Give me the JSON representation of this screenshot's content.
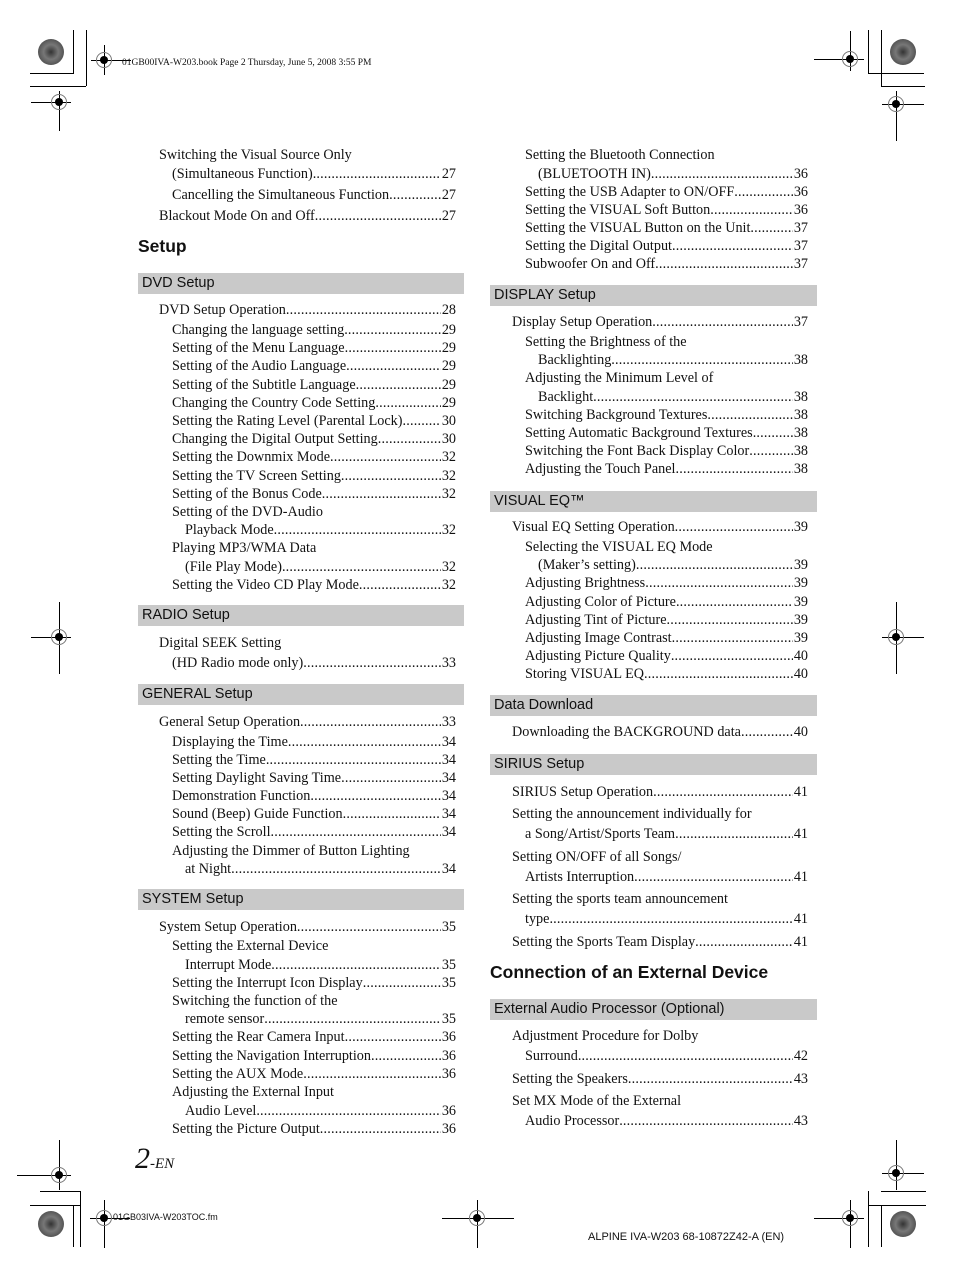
{
  "header": {
    "file_line": "01GB00IVA-W203.book  Page 2  Thursday, June 5, 2008  3:55 PM"
  },
  "footer": {
    "page_number": "2",
    "page_suffix": "-EN",
    "source_file": "01GB03IVA-W203TOC.fm",
    "product_code": "ALPINE IVA-W203 68-10872Z42-A (EN)"
  },
  "left": {
    "top_entries": [
      {
        "text": "Switching the Visual Source Only",
        "page": ""
      },
      {
        "text": "(Simultaneous Function)",
        "page": "27"
      },
      {
        "text": "Cancelling the Simultaneous Function",
        "page": "27"
      },
      {
        "text": "Blackout Mode On and Off",
        "page": "27"
      }
    ],
    "heading_setup": "Setup",
    "dvd": {
      "title": "DVD Setup",
      "entries": [
        {
          "text": "DVD Setup Operation",
          "page": "28"
        },
        {
          "text": "Changing the language setting",
          "page": "29"
        },
        {
          "text": "Setting of the Menu Language",
          "page": "29"
        },
        {
          "text": "Setting of the Audio Language",
          "page": "29"
        },
        {
          "text": "Setting of the Subtitle Language",
          "page": "29"
        },
        {
          "text": "Changing the Country Code Setting",
          "page": "29"
        },
        {
          "text": "Setting the Rating Level (Parental Lock)",
          "page": "30"
        },
        {
          "text": "Changing the Digital Output Setting",
          "page": "30"
        },
        {
          "text": "Setting the Downmix Mode",
          "page": "32"
        },
        {
          "text": "Setting the TV Screen Setting",
          "page": "32"
        },
        {
          "text": "Setting of the Bonus Code",
          "page": "32"
        },
        {
          "text": "Setting of the DVD-Audio",
          "page": ""
        },
        {
          "text": "Playback Mode",
          "page": "32"
        },
        {
          "text": "Playing MP3/WMA Data",
          "page": ""
        },
        {
          "text": "(File Play Mode)",
          "page": "32"
        },
        {
          "text": "Setting the Video CD Play Mode",
          "page": "32"
        }
      ]
    },
    "radio": {
      "title": "RADIO Setup",
      "entries": [
        {
          "text": "Digital SEEK Setting",
          "page": ""
        },
        {
          "text": "(HD Radio mode only)",
          "page": "33"
        }
      ]
    },
    "general": {
      "title": "GENERAL Setup",
      "entries": [
        {
          "text": "General Setup Operation",
          "page": "33"
        },
        {
          "text": "Displaying the Time",
          "page": "34"
        },
        {
          "text": "Setting the Time",
          "page": "34"
        },
        {
          "text": "Setting Daylight Saving Time",
          "page": "34"
        },
        {
          "text": "Demonstration Function",
          "page": "34"
        },
        {
          "text": "Sound (Beep) Guide Function",
          "page": "34"
        },
        {
          "text": "Setting the Scroll",
          "page": "34"
        },
        {
          "text": "Adjusting the Dimmer of Button Lighting",
          "page": ""
        },
        {
          "text": "at Night",
          "page": "34"
        }
      ]
    },
    "system": {
      "title": "SYSTEM Setup",
      "entries": [
        {
          "text": "System Setup Operation",
          "page": "35"
        },
        {
          "text": "Setting the External Device",
          "page": ""
        },
        {
          "text": "Interrupt Mode",
          "page": "35"
        },
        {
          "text": "Setting the Interrupt Icon Display",
          "page": "35"
        },
        {
          "text": "Switching the function of the",
          "page": ""
        },
        {
          "text": "remote sensor",
          "page": "35"
        },
        {
          "text": "Setting the Rear Camera Input",
          "page": "36"
        },
        {
          "text": "Setting the Navigation Interruption",
          "page": "36"
        },
        {
          "text": "Setting the AUX Mode",
          "page": "36"
        },
        {
          "text": "Adjusting the External Input",
          "page": ""
        },
        {
          "text": "Audio Level",
          "page": "36"
        },
        {
          "text": "Setting the Picture Output",
          "page": "36"
        }
      ]
    }
  },
  "right": {
    "top_entries": [
      {
        "text": "Setting the Bluetooth Connection",
        "page": ""
      },
      {
        "text": "(BLUETOOTH IN)",
        "page": "36"
      },
      {
        "text": "Setting the USB Adapter to ON/OFF",
        "page": "36"
      },
      {
        "text": "Setting the VISUAL Soft Button",
        "page": "36"
      },
      {
        "text": "Setting the VISUAL Button on the Unit",
        "page": "37"
      },
      {
        "text": "Setting the Digital Output",
        "page": "37"
      },
      {
        "text": "Subwoofer On and Off",
        "page": "37"
      }
    ],
    "display": {
      "title": "DISPLAY Setup",
      "entries": [
        {
          "text": "Display Setup Operation",
          "page": "37"
        },
        {
          "text": "Setting the Brightness of the",
          "page": ""
        },
        {
          "text": "Backlighting",
          "page": "38"
        },
        {
          "text": "Adjusting the Minimum Level of",
          "page": ""
        },
        {
          "text": "Backlight",
          "page": "38"
        },
        {
          "text": "Switching Background Textures",
          "page": "38"
        },
        {
          "text": "Setting Automatic Background Textures",
          "page": "38"
        },
        {
          "text": "Switching the Font Back Display Color",
          "page": "38"
        },
        {
          "text": "Adjusting the Touch Panel",
          "page": "38"
        }
      ]
    },
    "visualeq": {
      "title": "VISUAL EQ™",
      "entries": [
        {
          "text": "Visual EQ Setting Operation",
          "page": "39"
        },
        {
          "text": "Selecting the VISUAL EQ Mode",
          "page": ""
        },
        {
          "text": "(Maker’s setting)",
          "page": "39"
        },
        {
          "text": "Adjusting Brightness",
          "page": "39"
        },
        {
          "text": "Adjusting Color of Picture",
          "page": "39"
        },
        {
          "text": "Adjusting Tint of Picture",
          "page": "39"
        },
        {
          "text": "Adjusting Image Contrast",
          "page": "39"
        },
        {
          "text": "Adjusting Picture Quality",
          "page": "40"
        },
        {
          "text": "Storing VISUAL EQ",
          "page": "40"
        }
      ]
    },
    "download": {
      "title": "Data Download",
      "entries": [
        {
          "text": "Downloading the BACKGROUND data",
          "page": "40"
        }
      ]
    },
    "sirius": {
      "title": "SIRIUS Setup",
      "entries": [
        {
          "text": "SIRIUS Setup Operation",
          "page": "41"
        },
        {
          "text": "Setting the announcement individually for",
          "page": ""
        },
        {
          "text": "a Song/Artist/Sports Team",
          "page": "41"
        },
        {
          "text": "Setting ON/OFF of all Songs/",
          "page": ""
        },
        {
          "text": "Artists Interruption",
          "page": "41"
        },
        {
          "text": "Setting the sports team announcement",
          "page": ""
        },
        {
          "text": "type",
          "page": "41"
        },
        {
          "text": "Setting the Sports Team Display",
          "page": "41"
        }
      ]
    },
    "heading_connection": "Connection of an External Device",
    "external": {
      "title": "External Audio Processor (Optional)",
      "entries": [
        {
          "text": "Adjustment Procedure for Dolby",
          "page": ""
        },
        {
          "text": "Surround",
          "page": "42"
        },
        {
          "text": "Setting the Speakers",
          "page": "43"
        },
        {
          "text": "Set MX Mode of the External",
          "page": ""
        },
        {
          "text": "Audio Processor",
          "page": "43"
        }
      ]
    }
  }
}
